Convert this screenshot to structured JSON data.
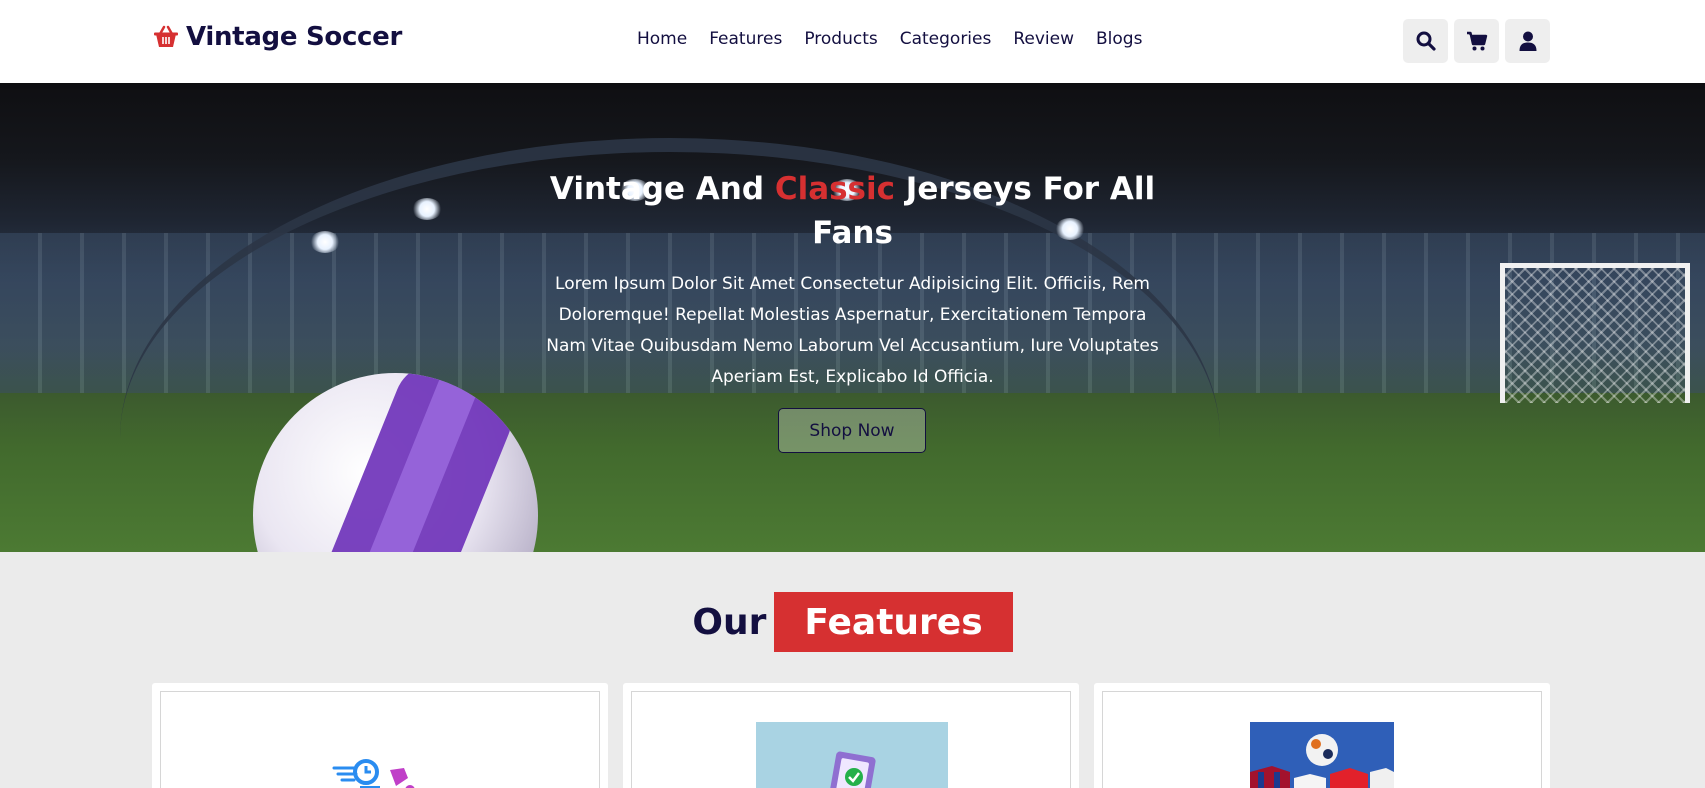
{
  "header": {
    "logo_text": "Vintage Soccer",
    "nav": [
      "Home",
      "Features",
      "Products",
      "Categories",
      "Review",
      "Blogs"
    ]
  },
  "hero": {
    "title_part1": "Vintage And ",
    "title_accent": "Classic",
    "title_part2": " Jerseys For All Fans",
    "description": "Lorem Ipsum Dolor Sit Amet Consectetur Adipisicing Elit. Officiis, Rem Doloremque! Repellat Molestias Aspernatur, Exercitationem Tempora Nam Vitae Quibusdam Nemo Laborum Vel Accusantium, Iure Voluptates Aperiam Est, Explicabo Id Officia.",
    "button": "Shop Now"
  },
  "features": {
    "heading_our": "Our",
    "heading_features": "Features"
  },
  "colors": {
    "accent": "#d63031",
    "dark": "#130f40",
    "background": "#ebebeb"
  },
  "icons": [
    "basket-icon",
    "search-icon",
    "cart-icon",
    "user-icon"
  ]
}
